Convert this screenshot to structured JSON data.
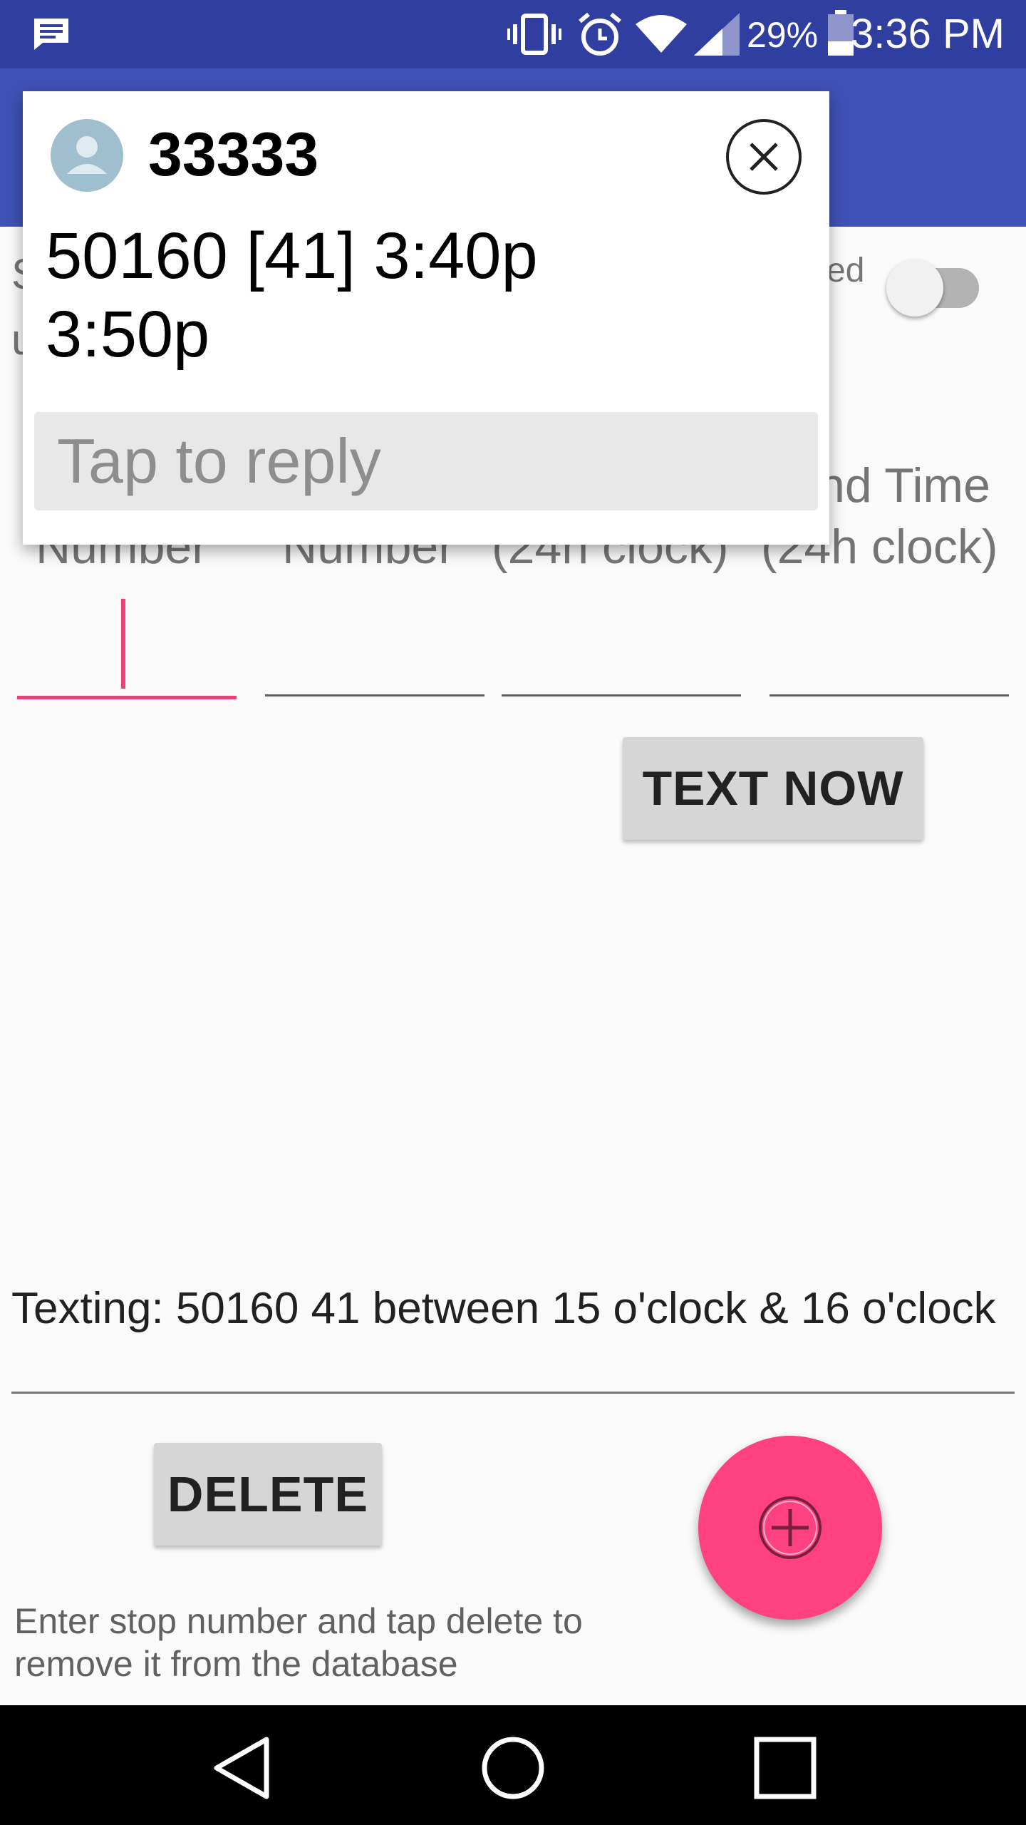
{
  "status_bar": {
    "battery_percent": "29%",
    "time": "3:36 PM",
    "icons": [
      "message-icon",
      "vibrate-icon",
      "alarm-icon",
      "wifi-icon",
      "signal-icon",
      "battery-icon"
    ]
  },
  "form": {
    "partial_label_1": "S",
    "partial_label_2": "u",
    "toggle_label_tail": "ed",
    "columns": [
      {
        "label": "Number"
      },
      {
        "label": "Number"
      },
      {
        "label": "(24h clock)"
      },
      {
        "label": "nd Time",
        "label2": "(24h clock)"
      }
    ],
    "text_now_button": "TEXT NOW"
  },
  "notification_popup": {
    "sender": "33333",
    "message": "50160 [41] 3:40p 3:50p",
    "reply_placeholder": "Tap to reply"
  },
  "status": {
    "texting_line": "Texting: 50160 41 between 15 o'clock & 16 o'clock"
  },
  "delete_section": {
    "delete_button": "DELETE",
    "hint": "Enter stop number and tap delete to remove it from the database"
  },
  "colors": {
    "primary_dark": "#303f9f",
    "primary": "#3f51b5",
    "accent": "#ff4081"
  }
}
